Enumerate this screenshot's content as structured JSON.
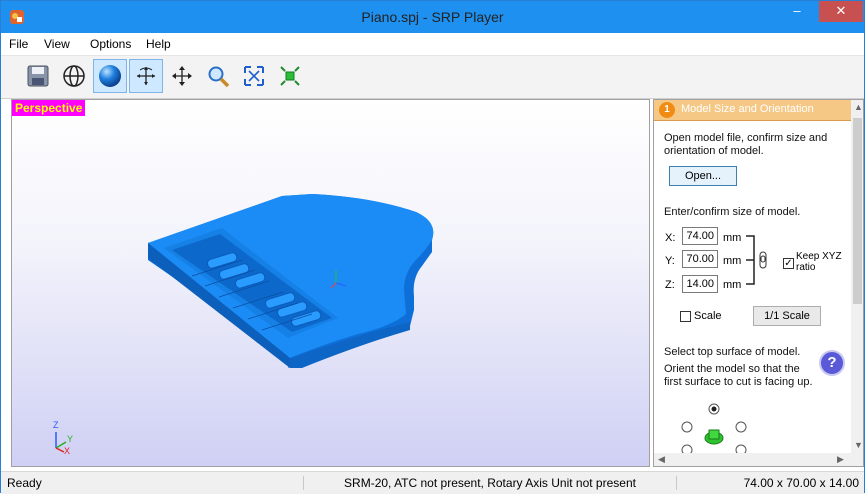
{
  "window": {
    "title": "Piano.spj - SRP Player",
    "minimize": "–",
    "maximize": "□",
    "close": "✕"
  },
  "menu": [
    "File",
    "View",
    "Options",
    "Help"
  ],
  "toolbar": [
    {
      "name": "save-icon",
      "active": false
    },
    {
      "name": "globe-icon",
      "active": false
    },
    {
      "name": "sphere-icon",
      "active": true
    },
    {
      "name": "rotate-icon",
      "active": true
    },
    {
      "name": "pan-icon",
      "active": false
    },
    {
      "name": "zoom-icon",
      "active": false
    },
    {
      "name": "fit-view-icon",
      "active": false
    },
    {
      "name": "fit-model-icon",
      "active": false
    }
  ],
  "viewport": {
    "label": "Perspective",
    "axis_z": "Z",
    "axis_y": "Y",
    "axis_x": "X"
  },
  "panel": {
    "step": "1",
    "title": "Model Size and Orientation",
    "open_desc": "Open model file, confirm size and orientation of model.",
    "open_button": "Open...",
    "size_desc": "Enter/confirm size of model.",
    "x_label": "X:",
    "x_value": "74.00",
    "y_label": "Y:",
    "y_value": "70.00",
    "z_label": "Z:",
    "z_value": "14.00",
    "unit": "mm",
    "keep_ratio": "Keep XYZ ratio",
    "keep_ratio_checked": true,
    "scale_label": "Scale",
    "scale_checked": false,
    "scale_button": "1/1 Scale",
    "surface_title": "Select top surface of model.",
    "surface_desc": "Orient the model so that the first surface to cut is facing up.",
    "help": "?"
  },
  "status": {
    "ready": "Ready",
    "machine": "SRM-20, ATC not present, Rotary Axis Unit not present",
    "size": "74.00 x 70.00 x 14.00"
  },
  "colors": {
    "titlebar": "#1e90f0",
    "model": "#1b8cf5",
    "highlight": "#ff00ff"
  }
}
